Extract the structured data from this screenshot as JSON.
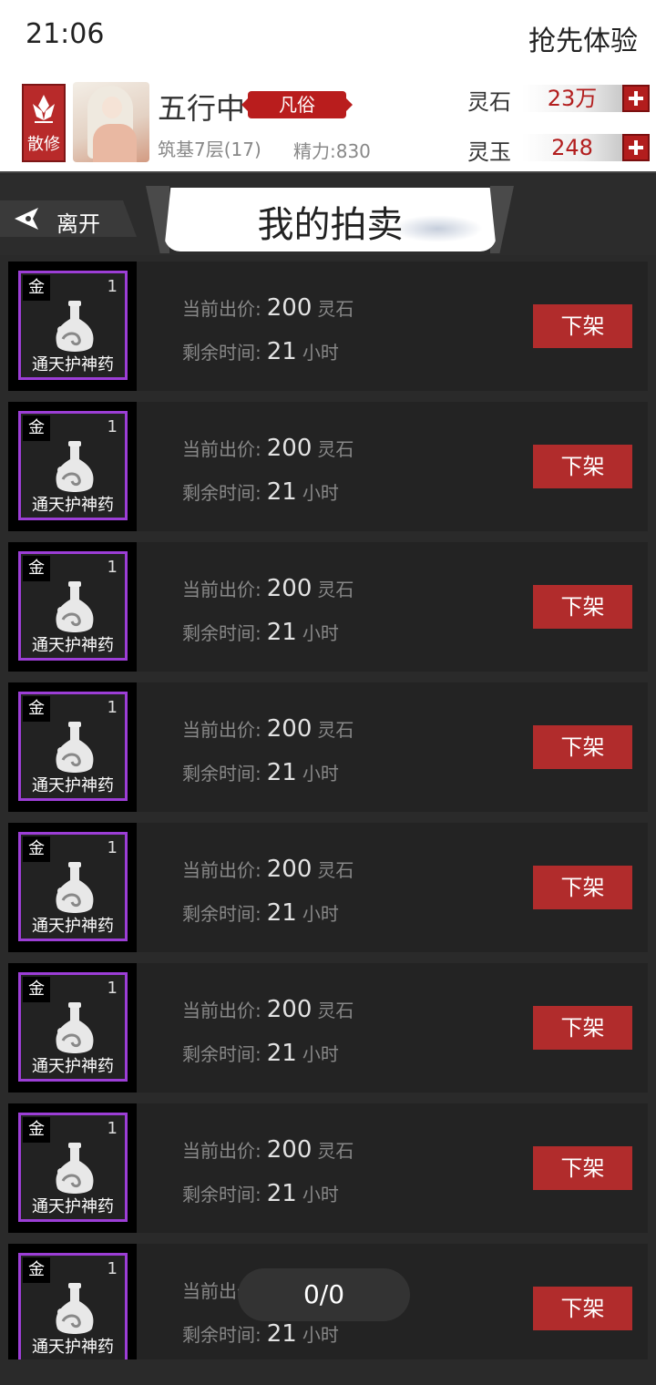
{
  "status_bar": {
    "time": "21:06",
    "promo_label": "抢先体验"
  },
  "header": {
    "sect_label": "散修",
    "player_name": "五行中",
    "realm": "凡俗",
    "cultivation": "筑基7层(17)",
    "stamina": "精力:830",
    "currencies": [
      {
        "label": "灵石",
        "value": "23万"
      },
      {
        "label": "灵玉",
        "value": "248"
      }
    ]
  },
  "nav": {
    "leave_label": "离开",
    "page_title": "我的拍卖"
  },
  "listing": {
    "price_label": "当前出价:",
    "time_label": "剩余时间:",
    "delist_label": "下架",
    "items": [
      {
        "element": "金",
        "quantity": "1",
        "name": "通天护神药",
        "price": "200",
        "price_unit": "灵石",
        "remaining": "21",
        "remaining_unit": "小时"
      },
      {
        "element": "金",
        "quantity": "1",
        "name": "通天护神药",
        "price": "200",
        "price_unit": "灵石",
        "remaining": "21",
        "remaining_unit": "小时"
      },
      {
        "element": "金",
        "quantity": "1",
        "name": "通天护神药",
        "price": "200",
        "price_unit": "灵石",
        "remaining": "21",
        "remaining_unit": "小时"
      },
      {
        "element": "金",
        "quantity": "1",
        "name": "通天护神药",
        "price": "200",
        "price_unit": "灵石",
        "remaining": "21",
        "remaining_unit": "小时"
      },
      {
        "element": "金",
        "quantity": "1",
        "name": "通天护神药",
        "price": "200",
        "price_unit": "灵石",
        "remaining": "21",
        "remaining_unit": "小时"
      },
      {
        "element": "金",
        "quantity": "1",
        "name": "通天护神药",
        "price": "200",
        "price_unit": "灵石",
        "remaining": "21",
        "remaining_unit": "小时"
      },
      {
        "element": "金",
        "quantity": "1",
        "name": "通天护神药",
        "price": "200",
        "price_unit": "灵石",
        "remaining": "21",
        "remaining_unit": "小时"
      },
      {
        "element": "金",
        "quantity": "1",
        "name": "通天护神药",
        "price": "",
        "price_unit": "",
        "remaining": "21",
        "remaining_unit": "小时"
      }
    ]
  },
  "page_indicator": "0/0"
}
